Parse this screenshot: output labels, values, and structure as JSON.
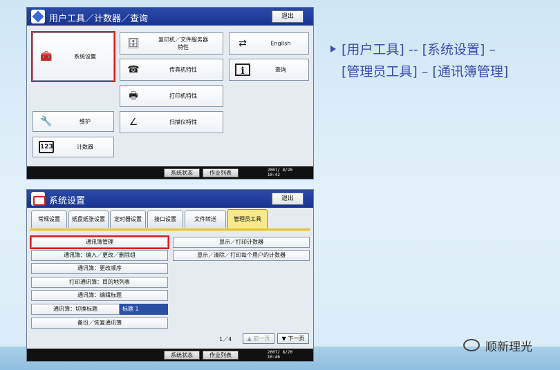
{
  "top_screen": {
    "title": "用户工具／计数器／查询",
    "exit_label": "退出",
    "buttons": {
      "system_settings": "系统设置",
      "copier_doc_server": "复印机／文件服务器\n特性",
      "english": "English",
      "fax": "传真机特性",
      "inquiry": "查询",
      "printer": "打印机特性",
      "maintenance": "维护",
      "scanner": "扫描仪特性",
      "counter": "计数器",
      "counter_icon_text": "123"
    },
    "status": {
      "system_status": "系统状态",
      "job_list": "作业列表",
      "date": "2007/ 8/20",
      "time": "10:42"
    }
  },
  "bottom_screen": {
    "title": "系统设置",
    "exit_label": "退出",
    "tabs": [
      "常规设置",
      "纸盘纸张设置",
      "定时器设置",
      "接口设置",
      "文件转送",
      "管理员工具"
    ],
    "active_tab": 5,
    "left_items": [
      "通讯簿管理",
      "通讯簿：编入／更改／删除组",
      "通讯簿：更改顺序",
      "打印通讯簿：目的地列表",
      "通讯簿：编辑标题",
      "通讯簿：切换标题",
      "备份／恢复通讯簿"
    ],
    "switch_title_value": "标题 1",
    "right_items": [
      "显示／打印计数器",
      "显示／清除／打印每个用户的计数器"
    ],
    "pager": {
      "page": "1／4",
      "prev": "▲ 前一页",
      "next": "▼ 下一页"
    },
    "status": {
      "system_status": "系统状态",
      "job_list": "作业列表",
      "date": "2007/ 8/20",
      "time": "10:46"
    }
  },
  "annotation": {
    "line1": "[用户工具] -- [系统设置] –",
    "line2": "[管理员工具] – [通讯簿管理]"
  },
  "watermark": "顺新理光",
  "colors": {
    "titlebar": "#1a3390",
    "highlight": "#d62020",
    "active_tab": "#f8e98a",
    "annotation": "#3b4bb0"
  }
}
